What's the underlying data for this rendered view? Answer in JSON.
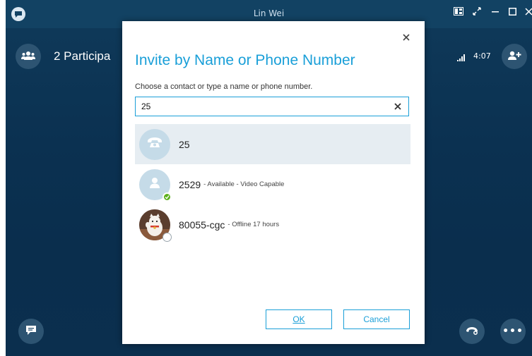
{
  "window": {
    "title": "Lin Wei",
    "participants_label": "2 Participa",
    "call_timer": "4:07"
  },
  "dialog": {
    "title": "Invite by Name or Phone Number",
    "instruction": "Choose a contact or type a name or phone number.",
    "search_value": "25",
    "results": [
      {
        "name": "25",
        "status": "",
        "icon": "phone-icon"
      },
      {
        "name": "2529",
        "status": "- Available - Video Capable",
        "icon": "person-icon",
        "presence": "available"
      },
      {
        "name": "80055-cgc",
        "status": "- Offline 17 hours",
        "icon": "photo-avatar",
        "presence": "offline"
      }
    ],
    "ok_label": "OK",
    "cancel_label": "Cancel"
  },
  "colors": {
    "accent": "#1a9fd8",
    "call_background": "#0b3151",
    "presence_available": "#5cb11c"
  }
}
